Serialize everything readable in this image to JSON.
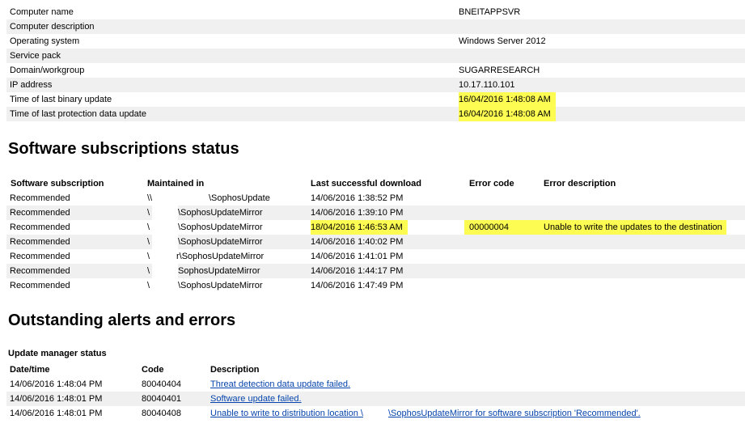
{
  "info": [
    {
      "label": "Computer name",
      "value": "BNEITAPPSVR"
    },
    {
      "label": "Computer description",
      "value": ""
    },
    {
      "label": "Operating system",
      "value": "Windows Server 2012"
    },
    {
      "label": "Service pack",
      "value": ""
    },
    {
      "label": "Domain/workgroup",
      "value": "SUGARRESEARCH"
    },
    {
      "label": "IP address",
      "value": "10.17.110.101"
    },
    {
      "label": "Time of last binary update",
      "value": "16/04/2016 1:48:08 AM"
    },
    {
      "label": "Time of last protection data update",
      "value": "16/04/2016 1:48:08 AM"
    }
  ],
  "subscriptions": {
    "title": "Software subscriptions status",
    "headers": {
      "subscription": "Software subscription",
      "maintained": "Maintained in",
      "last": "Last successful download",
      "code": "Error code",
      "desc": "Error description"
    },
    "rows": [
      {
        "subscription": "Recommended",
        "maintained_prefix": "\\\\",
        "maintained": "\\SophosUpdate",
        "last": "14/06/2016 1:38:52 PM",
        "code": "",
        "desc": ""
      },
      {
        "subscription": "Recommended",
        "maintained_prefix": "\\",
        "maintained": "\\SophosUpdateMirror",
        "last": "14/06/2016 1:39:10 PM",
        "code": "",
        "desc": ""
      },
      {
        "subscription": "Recommended",
        "maintained_prefix": "\\",
        "maintained": "\\SophosUpdateMirror",
        "last": "18/04/2016 1:46:53 AM",
        "code": "00000004",
        "desc": "Unable to write the updates to the destination"
      },
      {
        "subscription": "Recommended",
        "maintained_prefix": "\\",
        "maintained": "\\SophosUpdateMirror",
        "last": "14/06/2016 1:40:02 PM",
        "code": "",
        "desc": ""
      },
      {
        "subscription": "Recommended",
        "maintained_prefix": "\\",
        "maintained": "r\\SophosUpdateMirror",
        "last": "14/06/2016 1:41:01 PM",
        "code": "",
        "desc": ""
      },
      {
        "subscription": "Recommended",
        "maintained_prefix": "\\",
        "maintained": "SophosUpdateMirror",
        "last": "14/06/2016 1:44:17 PM",
        "code": "",
        "desc": ""
      },
      {
        "subscription": "Recommended",
        "maintained_prefix": "\\",
        "maintained": "\\SophosUpdateMirror",
        "last": "14/06/2016 1:47:49 PM",
        "code": "",
        "desc": ""
      }
    ]
  },
  "alerts": {
    "title": "Outstanding alerts and errors",
    "subtitle": "Update manager status",
    "headers": {
      "datetime": "Date/time",
      "code": "Code",
      "desc": "Description"
    },
    "rows": [
      {
        "datetime": "14/06/2016 1:48:04 PM",
        "code": "80040404",
        "desc": "Threat detection data update failed.",
        "desc2": ""
      },
      {
        "datetime": "14/06/2016 1:48:01 PM",
        "code": "80040401",
        "desc": "Software update failed.",
        "desc2": ""
      },
      {
        "datetime": "14/06/2016 1:48:01 PM",
        "code": "80040408",
        "desc": "Unable to write to distribution location \\",
        "desc2": "\\SophosUpdateMirror for software subscription 'Recommended'."
      }
    ]
  },
  "colors": {
    "highlight": "#fcfc52",
    "alt_row": "#f0f0f0",
    "link": "#0645ad"
  }
}
